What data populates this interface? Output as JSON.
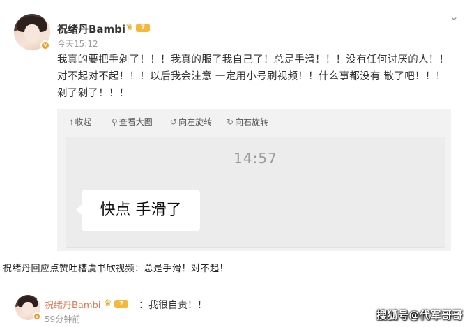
{
  "post": {
    "username": "祝绪丹Bambi",
    "level": "7",
    "timestamp": "今天15:12",
    "more_icon": "chevron-down-icon",
    "text": "我真的要把手剁了！！！我真的服了我自己了！总是手滑！！！没有任何讨厌的人！！对不起对不起！！！以后我会注意 一定用小号刷视频！！什么事都没有 散了吧！！！剁了剁了！！！"
  },
  "media_toolbar": {
    "collapse": "收起",
    "view_large": "查看大图",
    "rotate_left": "向左旋转",
    "rotate_right": "向右旋转"
  },
  "screenshot": {
    "clock": "14:57",
    "bubble": "快点 手滑了"
  },
  "caption": "祝绪丹回应点赞吐槽虞书欣视频：总是手滑！对不起！",
  "reply": {
    "username": "祝绪丹Bambi",
    "level": "7",
    "text": "：我很自责！！",
    "timestamp": "59分钟前"
  },
  "watermark": "搜狐号@代军哥哥"
}
